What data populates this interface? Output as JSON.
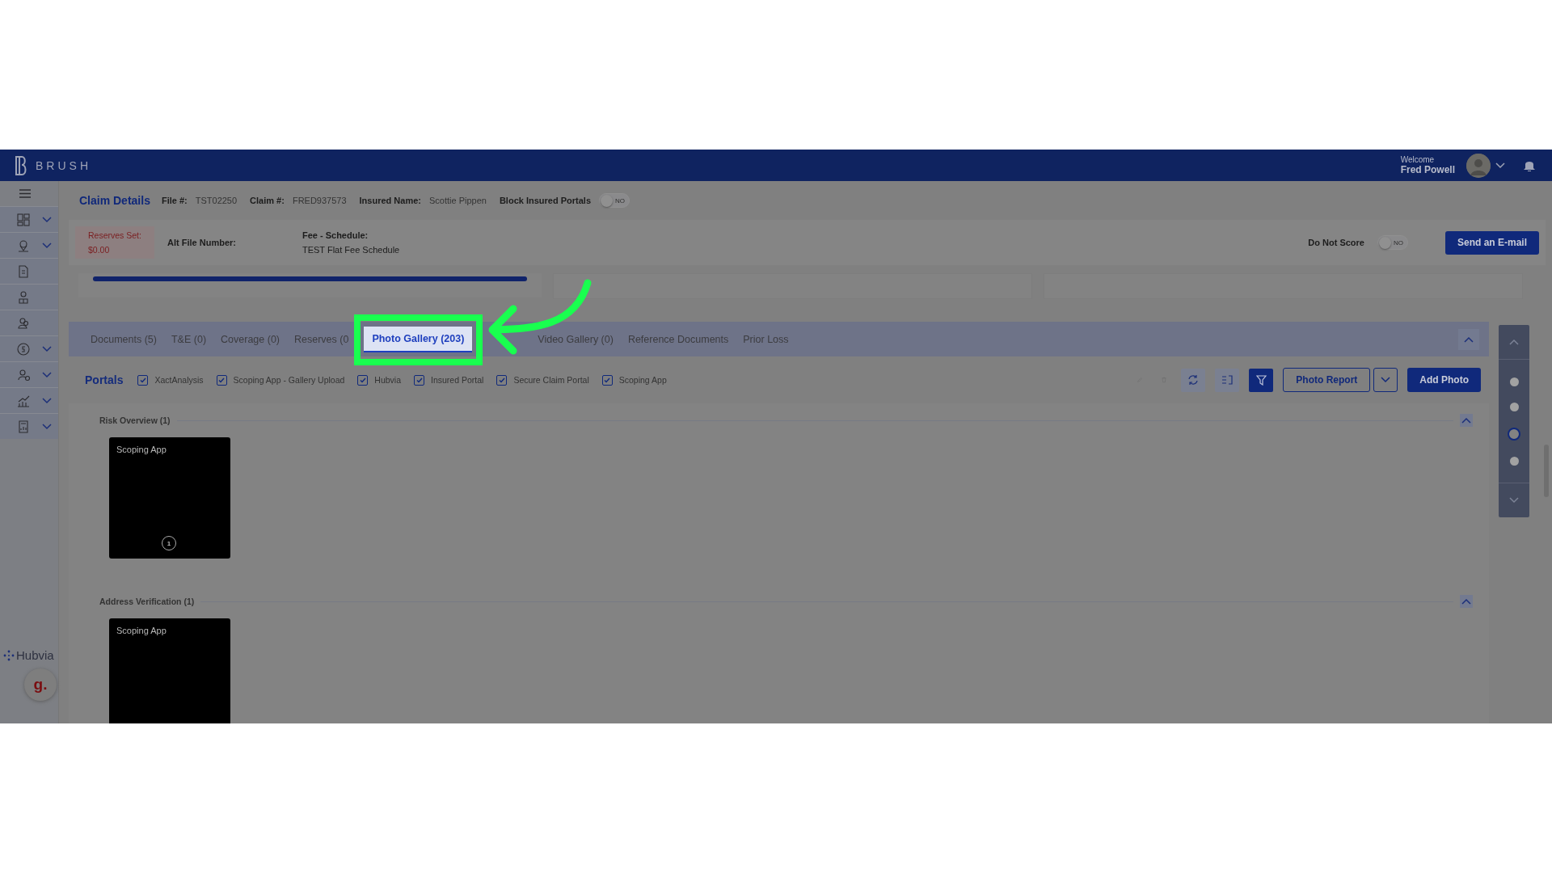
{
  "header": {
    "logo": "BRUSH",
    "welcome": "Welcome",
    "user_name": "Fred Powell"
  },
  "sidebar": {
    "items": [
      {
        "kind": "dashboard",
        "has_submenu": true
      },
      {
        "kind": "location",
        "has_submenu": true
      },
      {
        "kind": "document",
        "has_submenu": false
      },
      {
        "kind": "adjuster",
        "has_submenu": false
      },
      {
        "kind": "people",
        "has_submenu": false
      },
      {
        "kind": "money",
        "has_submenu": true
      },
      {
        "kind": "user-check",
        "has_submenu": true
      },
      {
        "kind": "chart",
        "has_submenu": true
      },
      {
        "kind": "report",
        "has_submenu": true
      }
    ],
    "brand": "Hubvia",
    "badge": "g."
  },
  "claim": {
    "title": "Claim Details",
    "fields": [
      {
        "label": "File #:",
        "value": "TST02250"
      },
      {
        "label": "Claim #:",
        "value": "FRED937573"
      },
      {
        "label": "Insured Name:",
        "value": "Scottie Pippen"
      }
    ],
    "block_portals": {
      "label": "Block Insured Portals",
      "on": false,
      "state_text": "NO"
    }
  },
  "summary": {
    "reserves_label": "Reserves Set:",
    "reserves_value": "$0.00",
    "alt_file_label": "Alt File Number:",
    "fee_label": "Fee - Schedule:",
    "fee_value": "TEST Flat Fee Schedule",
    "do_not_score": {
      "label": "Do Not Score",
      "on": false,
      "state_text": "NO"
    },
    "email_button": "Send an E-mail"
  },
  "progress": {
    "level": 1
  },
  "tabs": [
    {
      "label": "Documents (5)",
      "selected": false
    },
    {
      "label": "T&E (0)",
      "selected": false
    },
    {
      "label": "Coverage (0)",
      "selected": false
    },
    {
      "label": "Reserves (0",
      "selected": false
    },
    {
      "label": "Photo Gallery (203)",
      "selected": true
    },
    {
      "label": "Video Gallery (0)",
      "selected": false
    },
    {
      "label": "Reference Documents",
      "selected": false
    },
    {
      "label": "Prior Loss",
      "selected": false
    }
  ],
  "portals": {
    "title": "Portals",
    "items": [
      {
        "label": "XactAnalysis",
        "checked": true
      },
      {
        "label": "Scoping App - Gallery Upload",
        "checked": true
      },
      {
        "label": "Hubvia",
        "checked": true
      },
      {
        "label": "Insured Portal",
        "checked": true
      },
      {
        "label": "Secure Claim Portal",
        "checked": true
      },
      {
        "label": "Scoping App",
        "checked": true
      }
    ]
  },
  "toolbar": {
    "report_button": "Photo Report",
    "add_button": "Add Photo"
  },
  "sections": [
    {
      "title": "Risk Overview (1)",
      "photos": [
        {
          "source": "Scoping App",
          "count": "1"
        }
      ]
    },
    {
      "title": "Address Verification (1)",
      "photos": [
        {
          "source": "Scoping App"
        }
      ]
    }
  ],
  "side_nav": {
    "dots": [
      {
        "selected": false
      },
      {
        "selected": false
      },
      {
        "selected": true
      },
      {
        "selected": false
      }
    ]
  }
}
